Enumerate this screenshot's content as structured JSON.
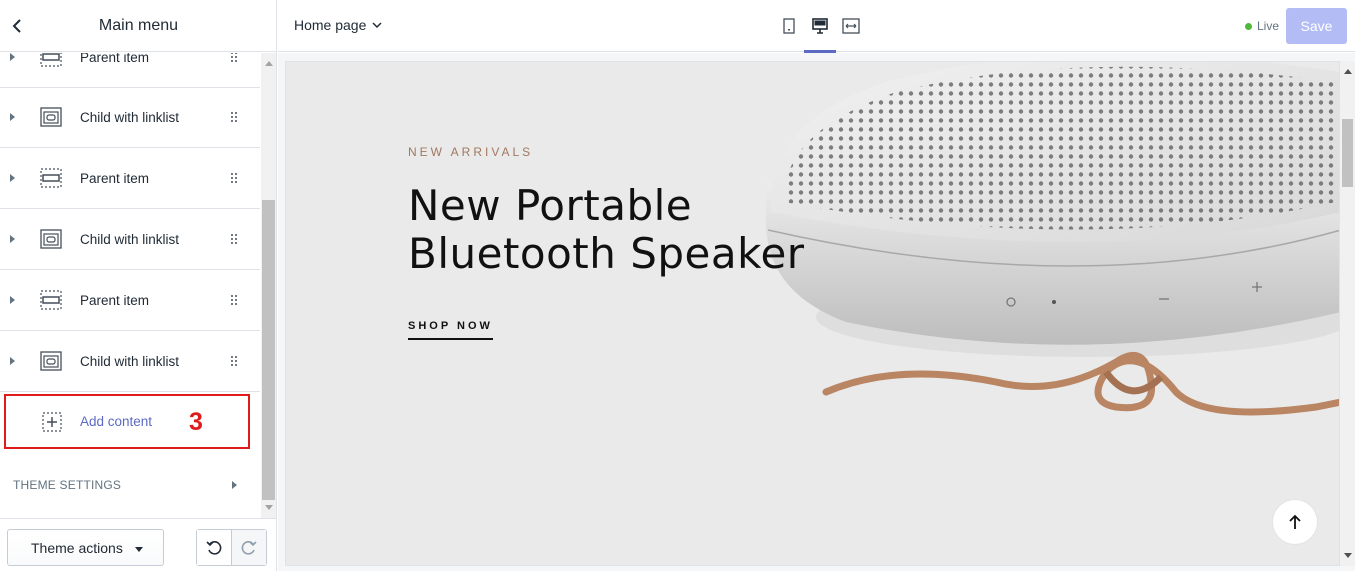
{
  "sidebar": {
    "title": "Main menu",
    "items": [
      {
        "label": "Parent item",
        "icon": "parent-item-icon"
      },
      {
        "label": "Child with linklist",
        "icon": "linklist-icon"
      },
      {
        "label": "Parent item",
        "icon": "parent-item-icon"
      },
      {
        "label": "Child with linklist",
        "icon": "linklist-icon"
      },
      {
        "label": "Parent item",
        "icon": "parent-item-icon"
      },
      {
        "label": "Child with linklist",
        "icon": "linklist-icon"
      }
    ],
    "add_content": {
      "label": "Add content",
      "annotation": "3",
      "annotation_color": "#e01b1b"
    },
    "theme_settings": "THEME SETTINGS",
    "footer": {
      "theme_actions": "Theme actions"
    }
  },
  "topbar": {
    "page": "Home page",
    "live": "Live",
    "save": "Save",
    "accent_color": "#5c6ac4",
    "active_device": "desktop"
  },
  "preview": {
    "eyebrow": "NEW ARRIVALS",
    "title_line1": "New Portable",
    "title_line2": "Bluetooth Speaker",
    "cta": "SHOP NOW"
  }
}
